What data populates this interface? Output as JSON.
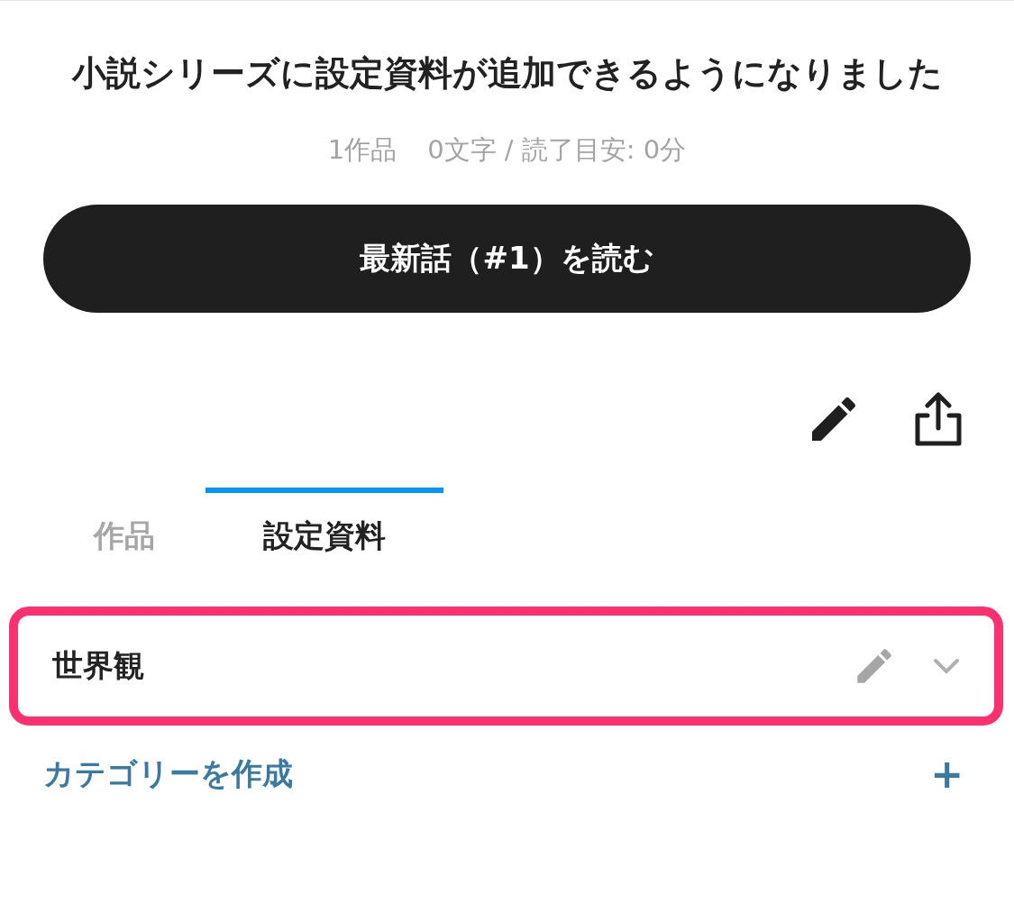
{
  "title": "小説シリーズに設定資料が追加できるようになりました",
  "meta": {
    "works": "1作品",
    "stats": "0文字 / 読了目安: 0分"
  },
  "read_button": "最新話（#1）を読む",
  "tabs": [
    {
      "label": "作品",
      "selected": false
    },
    {
      "label": "設定資料",
      "selected": true
    }
  ],
  "categories": [
    {
      "name": "世界観",
      "highlighted": true
    }
  ],
  "create_category": {
    "label": "カテゴリーを作成",
    "icon": "+"
  }
}
